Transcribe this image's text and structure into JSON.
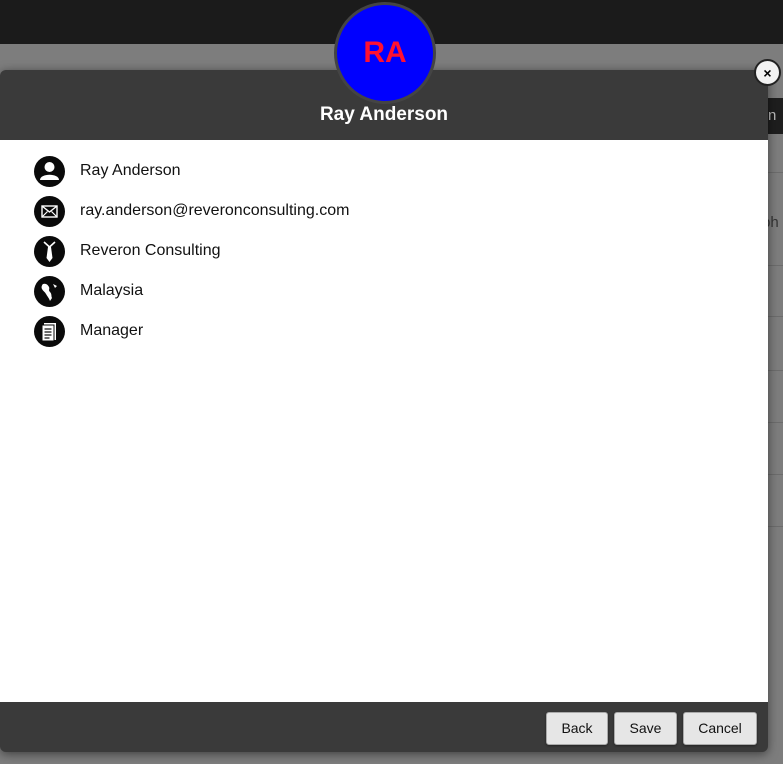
{
  "profile": {
    "initials": "RA",
    "name": "Ray Anderson",
    "avatar_bg_color": "#0000ff",
    "avatar_text_color": "#ff1030"
  },
  "details": [
    {
      "icon": "person-icon",
      "value": "Ray Anderson"
    },
    {
      "icon": "mail-icon",
      "value": "ray.anderson@reveronconsulting.com"
    },
    {
      "icon": "tie-icon",
      "value": "Reveron Consulting"
    },
    {
      "icon": "globe-icon",
      "value": "Malaysia"
    },
    {
      "icon": "document-icon",
      "value": "Manager"
    }
  ],
  "footer": {
    "back_label": "Back",
    "save_label": "Save",
    "cancel_label": "Cancel"
  },
  "background": {
    "header_fragment": "n",
    "row_fragment": "ph"
  },
  "close_label": "×"
}
